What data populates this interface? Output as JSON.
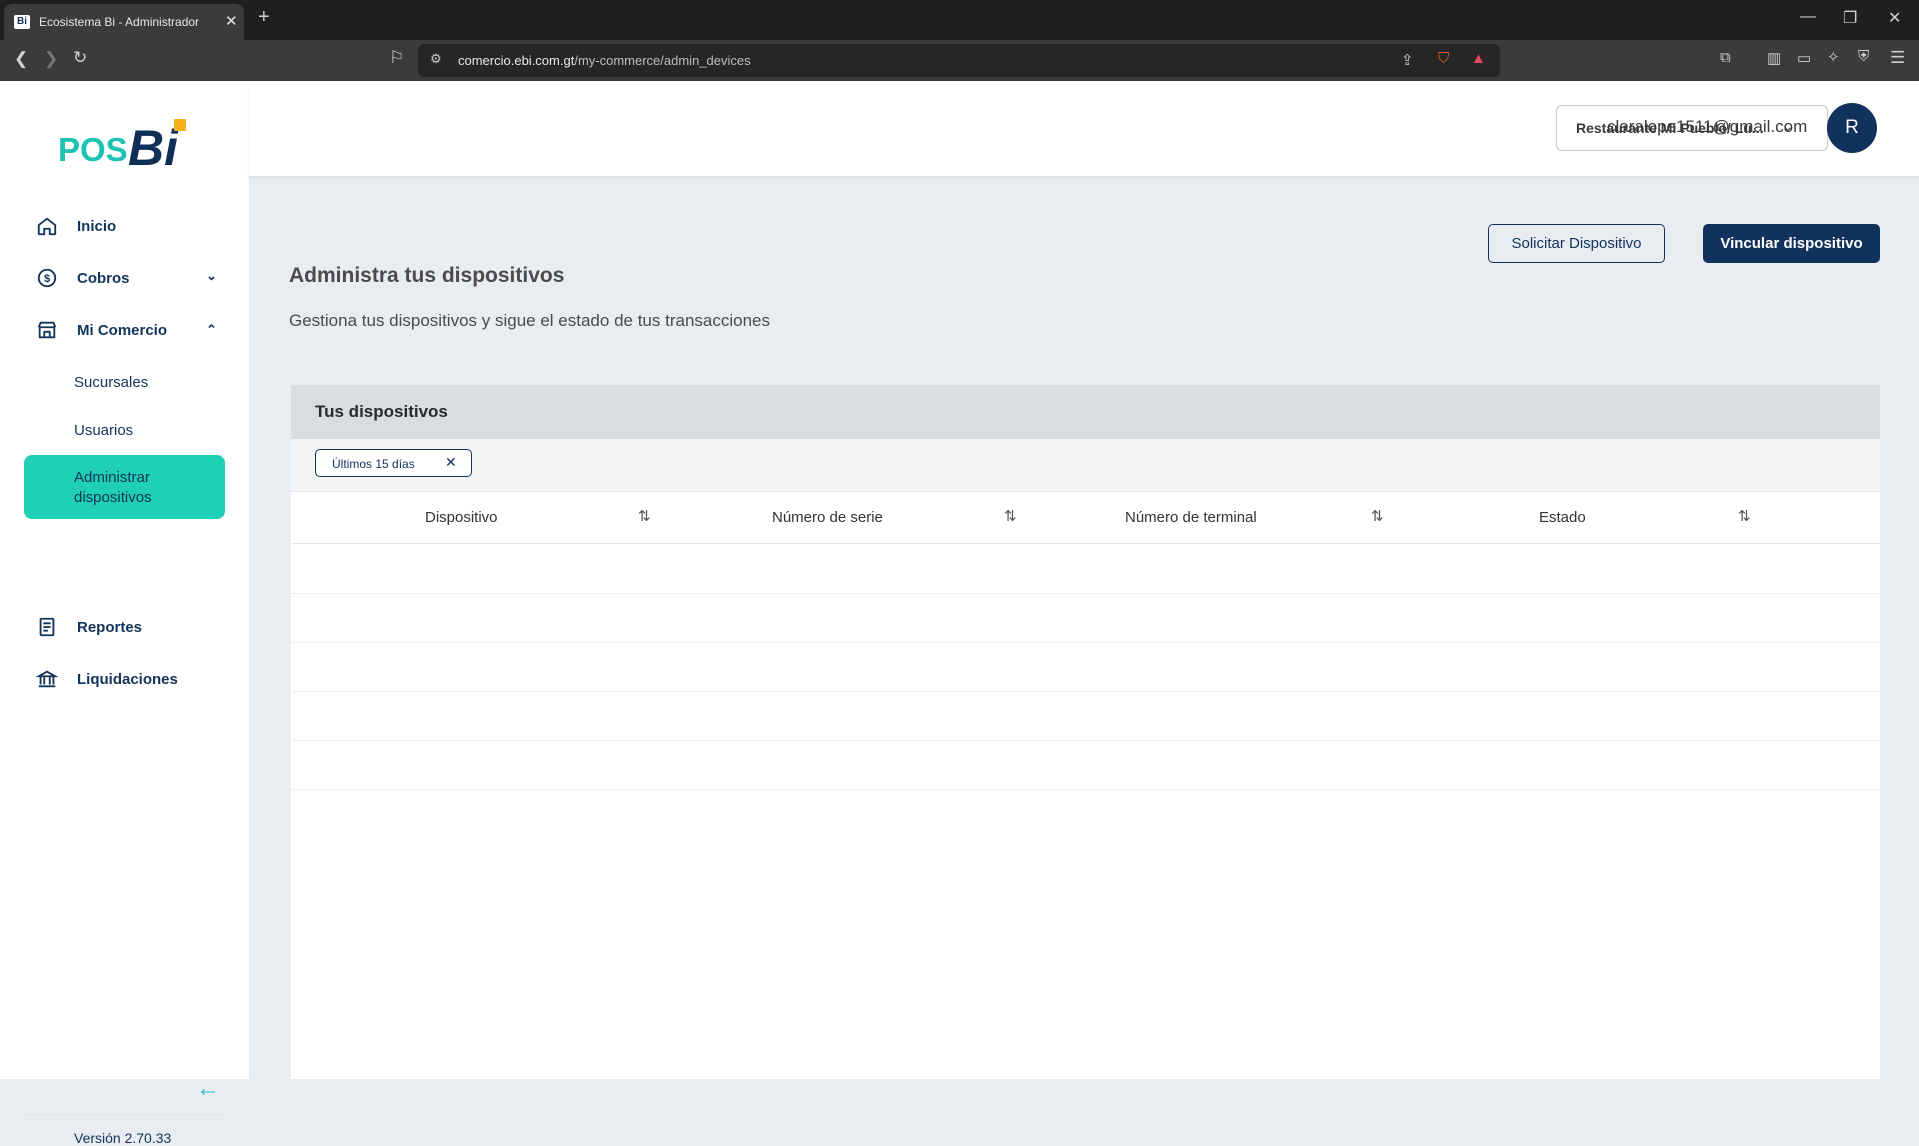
{
  "browser": {
    "tab_title": "Ecosistema Bi - Administrador",
    "tab_favicon": "Bi",
    "url_host": "comercio.ebi.com.gt",
    "url_path": "/my-commerce/admin_devices"
  },
  "logo": {
    "pos": "POS",
    "bi": "Bi"
  },
  "sidebar": {
    "inicio": "Inicio",
    "cobros": "Cobros",
    "mi_comercio": "Mi Comercio",
    "sucursales": "Sucursales",
    "usuarios": "Usuarios",
    "administrar": "Administrar dispositivos",
    "reportes": "Reportes",
    "liquidaciones": "Liquidaciones",
    "version": "Versión 2.70.33"
  },
  "header": {
    "branch": "Restaurante Mi Pueblo/ Lu...",
    "email": "claralope1511@gmail.com",
    "avatar_initial": "R"
  },
  "actions": {
    "request": "Solicitar Dispositivo",
    "link": "Vincular dispositivo"
  },
  "page": {
    "title": "Administra tus dispositivos",
    "subtitle": "Gestiona tus dispositivos y sigue el estado de tus transacciones"
  },
  "card": {
    "title": "Tus dispositivos",
    "filter_chip": "Últimos 15 días",
    "columns": [
      "Dispositivo",
      "Número de serie",
      "Número de terminal",
      "Estado"
    ]
  },
  "colors": {
    "brand_navy": "#10325c",
    "brand_teal": "#1fcfb6",
    "brand_yellow": "#f6b21b"
  }
}
